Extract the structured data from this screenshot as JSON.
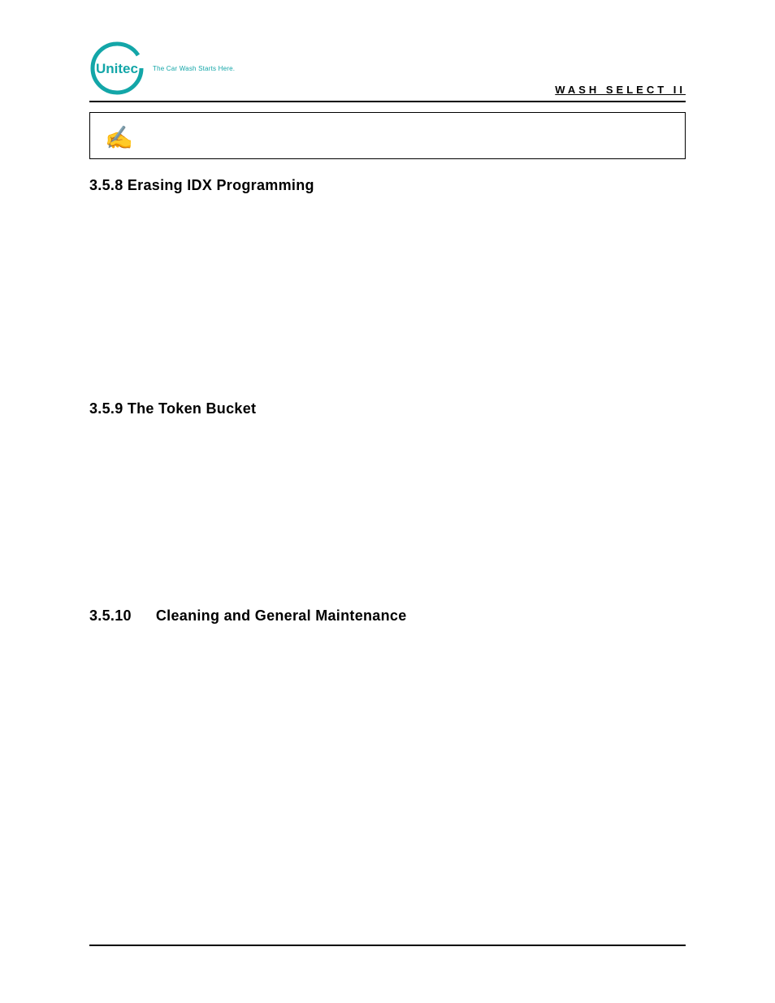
{
  "header": {
    "logo_text": "Unitec",
    "tagline": "The Car Wash Starts Here.",
    "doc_title": "WASH SELECT II"
  },
  "note": {
    "icon_glyph": "✍"
  },
  "sections": {
    "s358": "3.5.8 Erasing IDX Programming",
    "s359": "3.5.9 The Token Bucket",
    "s3510_num": "3.5.10",
    "s3510_title": "Cleaning and General Maintenance"
  }
}
